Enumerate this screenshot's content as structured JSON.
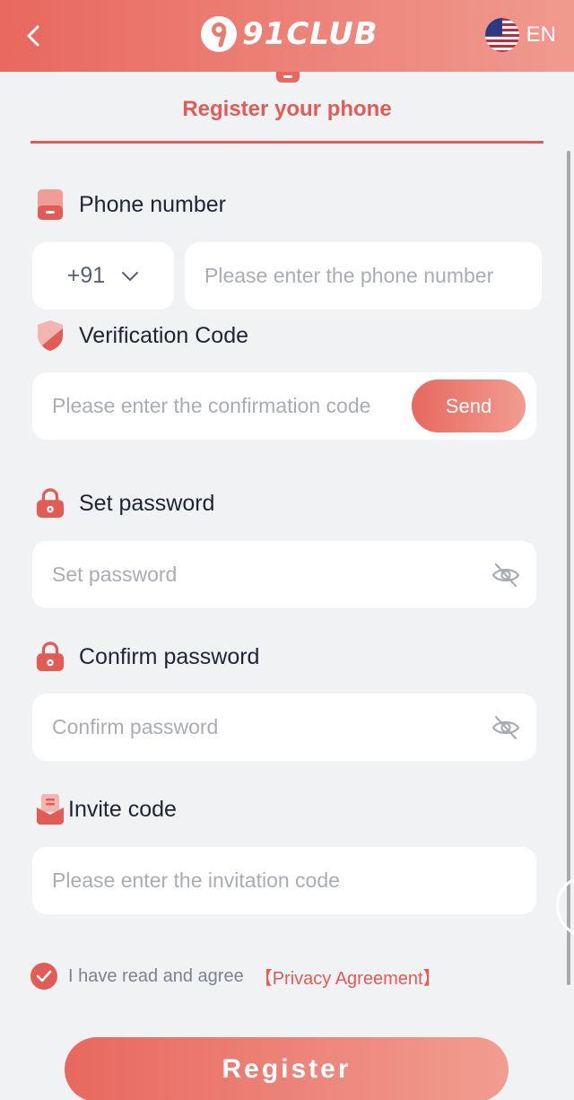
{
  "header": {
    "logo_text": "91CLUB",
    "language": "EN"
  },
  "tab": {
    "title": "Register your phone"
  },
  "phone": {
    "label": "Phone number",
    "country_code": "+91",
    "placeholder": "Please enter the phone number"
  },
  "verification": {
    "label": "Verification Code",
    "placeholder": "Please enter the confirmation code",
    "send_label": "Send"
  },
  "password": {
    "label": "Set password",
    "placeholder": "Set password"
  },
  "confirm_password": {
    "label": "Confirm password",
    "placeholder": "Confirm password"
  },
  "invite": {
    "label": "Invite code",
    "placeholder": "Please enter the invitation code"
  },
  "agreement": {
    "text": "I have read and agree",
    "link": "【Privacy Agreement】",
    "checked": true
  },
  "register_button": "Register",
  "colors": {
    "accent": "#e25b54",
    "header_start": "#e8685f",
    "header_end": "#f09a8e",
    "background": "#f1f2f4"
  }
}
